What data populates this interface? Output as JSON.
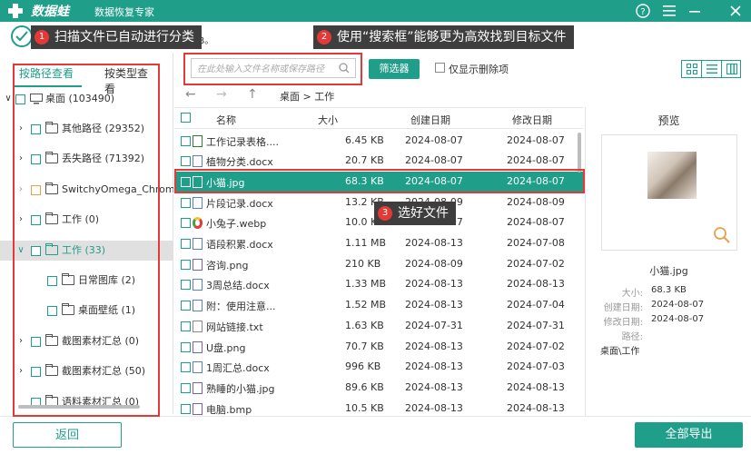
{
  "app": {
    "name": "数据蛙",
    "subtitle": "数据恢复专家"
  },
  "window": {
    "help_icon": "help-icon",
    "menu_icon": "menu-icon",
    "minimize_icon": "minimize-icon",
    "close_icon": "close-icon"
  },
  "status": {
    "tail_text": "dB。"
  },
  "callouts": [
    {
      "num": "1",
      "text": "扫描文件已自动进行分类"
    },
    {
      "num": "2",
      "text": "使用“搜索框”能够更为高效找到目标文件"
    },
    {
      "num": "3",
      "text": "选好文件"
    }
  ],
  "left_tabs": [
    "按路径查看",
    "按类型查看"
  ],
  "tree": [
    {
      "label": "桌面 (103490)",
      "arrow": "∨",
      "icon": "desktop"
    },
    {
      "label": "其他路径 (29352)",
      "arrow": "›",
      "icon": "folder"
    },
    {
      "label": "丢失路径 (71392)",
      "arrow": "›",
      "icon": "folder"
    },
    {
      "label": "SwitchyOmega_Chromium",
      "arrow": "›",
      "icon": "folder"
    },
    {
      "label": "工作 (0)",
      "arrow": "›",
      "icon": "folder"
    },
    {
      "label": "工作 (33)",
      "arrow": "∨",
      "icon": "folder"
    },
    {
      "label": "日常图库 (2)",
      "arrow": "",
      "icon": "folder"
    },
    {
      "label": "桌面壁纸 (1)",
      "arrow": "",
      "icon": "folder"
    },
    {
      "label": "截图素材汇总 (0)",
      "arrow": "›",
      "icon": "folder"
    },
    {
      "label": "截图素材汇总 (50)",
      "arrow": "›",
      "icon": "folder"
    },
    {
      "label": "语料素材汇总 (0)",
      "arrow": "",
      "icon": "folder"
    }
  ],
  "toolbar": {
    "search_placeholder": "在此处输入文件名称或保存路径",
    "filter_label": "筛选器",
    "show_deleted_label": "仅显示删除项"
  },
  "breadcrumb": "桌面 > 工作",
  "columns": [
    "名称",
    "大小",
    "创建日期",
    "修改日期"
  ],
  "files": [
    {
      "name": "工作记录表格....",
      "size": "6.45 KB",
      "created": "2024-08-07",
      "modified": "2024-08-07",
      "type": "xls"
    },
    {
      "name": "植物分类.docx",
      "size": "20.7 KB",
      "created": "2024-08-07",
      "modified": "2024-08-07",
      "type": "doc"
    },
    {
      "name": "小猫.jpg",
      "size": "68.3 KB",
      "created": "2024-08-07",
      "modified": "2024-08-07",
      "type": "img"
    },
    {
      "name": "片段记录.docx",
      "size": "13.2 KB",
      "created": "2024-08-09",
      "modified": "2024-08-09",
      "type": "doc"
    },
    {
      "name": "小兔子.webp",
      "size": "10.0 KB",
      "created": "2024-08-07",
      "modified": "2024-08-07",
      "type": "web"
    },
    {
      "name": "语段积累.docx",
      "size": "1.11 MB",
      "created": "2024-08-13",
      "modified": "2024-07-08",
      "type": "doc"
    },
    {
      "name": "咨询.png",
      "size": "210 KB",
      "created": "2024-08-09",
      "modified": "2024-07-02",
      "type": "img"
    },
    {
      "name": "3周总结.docx",
      "size": "1.33 MB",
      "created": "2024-08-13",
      "modified": "2024-08-13",
      "type": "doc"
    },
    {
      "name": "附：使用注意...",
      "size": "1.52 MB",
      "created": "2024-08-13",
      "modified": "2024-07-04",
      "type": "doc"
    },
    {
      "name": "网站链接.txt",
      "size": "1.63 KB",
      "created": "2024-07-31",
      "modified": "2024-07-31",
      "type": "txt"
    },
    {
      "name": "U盘.png",
      "size": "70.7 KB",
      "created": "2024-08-13",
      "modified": "2024-07-02",
      "type": "img"
    },
    {
      "name": "1周汇总.docx",
      "size": "996 KB",
      "created": "2024-08-13",
      "modified": "2024-07-03",
      "type": "doc"
    },
    {
      "name": "熟睡的小猫.jpg",
      "size": "89.6 KB",
      "created": "2024-08-13",
      "modified": "2024-08-13",
      "type": "img"
    },
    {
      "name": "电脑.bmp",
      "size": "10.5 KB",
      "created": "2024-08-13",
      "modified": "2024-08-13",
      "type": "img"
    }
  ],
  "preview": {
    "title": "预览",
    "filename": "小猫.jpg",
    "size_label": "大小:",
    "size_value": "68.3 KB",
    "created_label": "创建日期:",
    "created_value": "2024-08-07",
    "modified_label": "修改日期:",
    "modified_value": "2024-08-07",
    "path_label": "路径:",
    "path_value": "桌面\\工作"
  },
  "bottom": {
    "back_label": "返回",
    "export_label": "全部导出"
  },
  "colors": {
    "accent": "#1f9e8a",
    "highlight": "#e53935",
    "callout_bg": "#3e3e3e"
  }
}
